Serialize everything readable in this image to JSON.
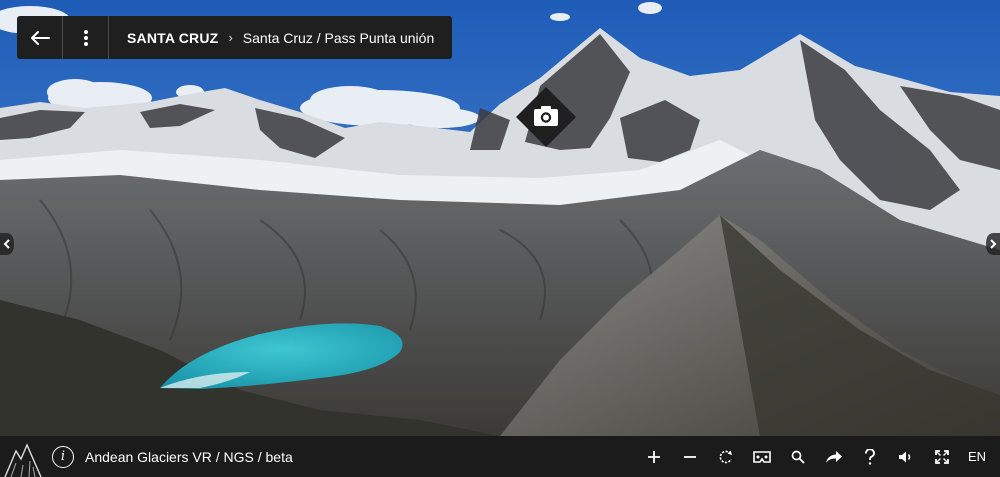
{
  "header": {
    "back_icon": "arrow-left-icon",
    "menu_icon": "more-vertical-icon",
    "breadcrumb_root": "SANTA CRUZ",
    "breadcrumb_separator": "›",
    "breadcrumb_current": "Santa Cruz / Pass Punta unión"
  },
  "hotspot": {
    "icon": "camera-icon"
  },
  "navigation": {
    "left_icon": "chevron-left-icon",
    "right_icon": "chevron-right-icon"
  },
  "footer": {
    "logo_icon": "mountain-logo-icon",
    "info_label": "i",
    "title": "Andean Glaciers VR / NGS / beta",
    "tools": [
      {
        "name": "zoom-in-icon"
      },
      {
        "name": "zoom-out-icon"
      },
      {
        "name": "rotate-icon"
      },
      {
        "name": "vr-headset-icon"
      },
      {
        "name": "search-icon"
      },
      {
        "name": "share-icon"
      },
      {
        "name": "help-icon"
      },
      {
        "name": "volume-icon"
      },
      {
        "name": "fullscreen-icon"
      }
    ],
    "language": "EN"
  },
  "colors": {
    "bar_bg": "#1f1f1f",
    "sky": "#2f6fc4",
    "lake": "#2bb3c4"
  }
}
